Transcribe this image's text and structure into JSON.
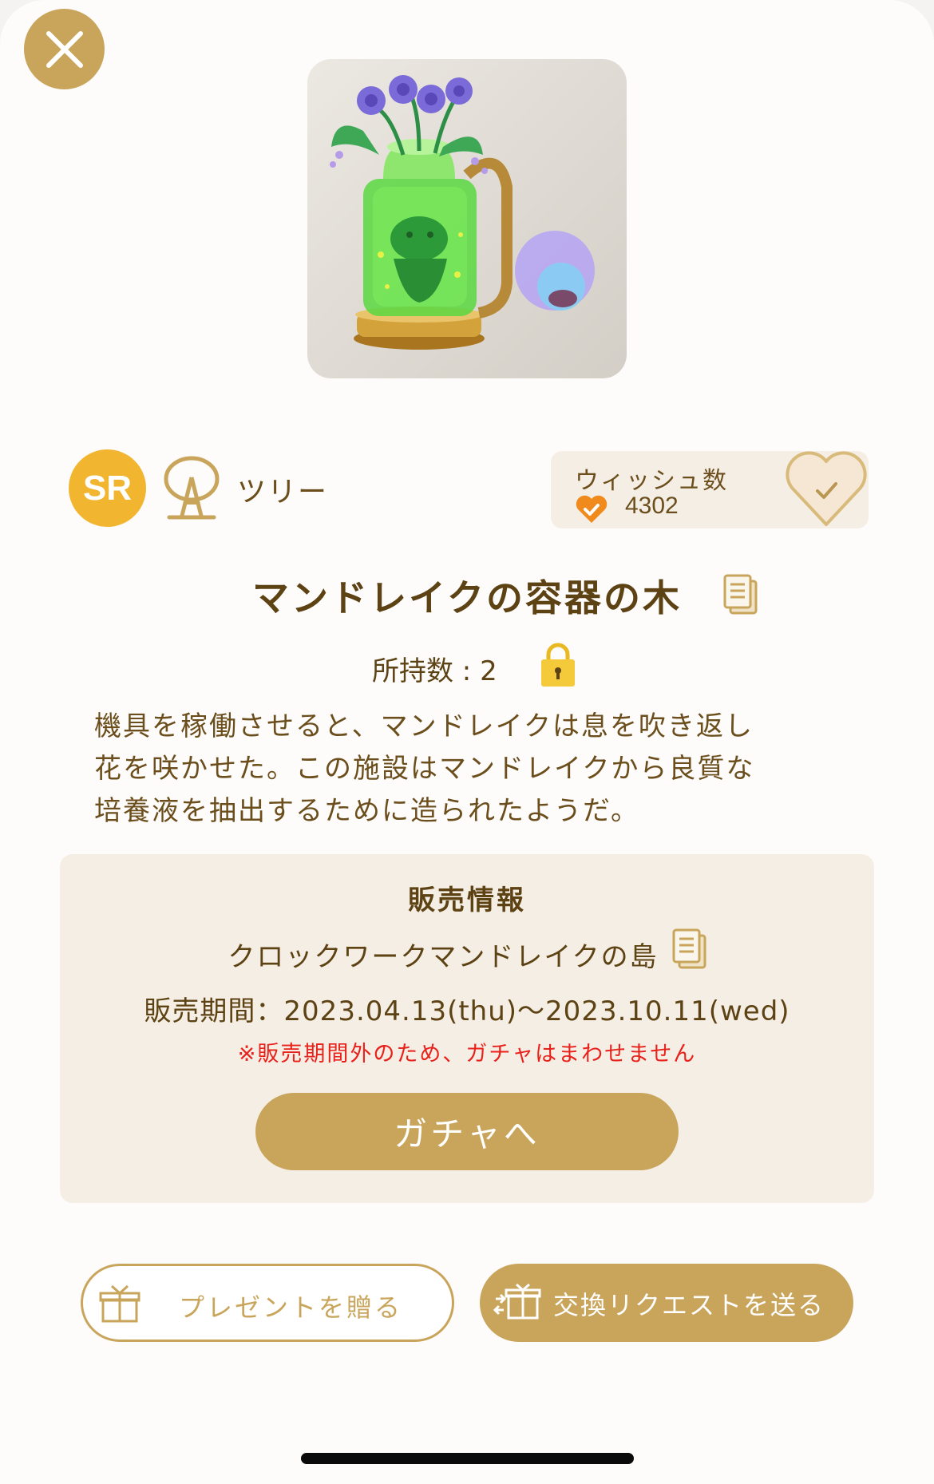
{
  "item": {
    "name": "マンドレイクの容器の木",
    "rarity": "SR",
    "category": "ツリー",
    "owned_label": "所持数 : 2",
    "description_lines": [
      "機具を稼働させると、マンドレイクは息を吹き返し",
      "花を咲かせた。この施設はマンドレイクから良質な",
      "培養液を抽出するために造られたようだ。"
    ]
  },
  "wish": {
    "label": "ウィッシュ数",
    "count": "4302"
  },
  "sales": {
    "heading": "販売情報",
    "island": "クロックワークマンドレイクの島",
    "period": "販売期間：2023.04.13(thu)〜2023.10.11(wed)",
    "warning": "※販売期間外のため、ガチャはまわせません",
    "gacha_button": "ガチャへ"
  },
  "actions": {
    "present_label": "プレゼントを贈る",
    "exchange_label": "交換リクエストを送る"
  },
  "colors": {
    "accent_gold": "#c9a55c",
    "rarity_yellow": "#f2b52f",
    "text_brown": "#6b4e1c",
    "panel_beige": "#f5eee4",
    "warning_red": "#e8211b",
    "heart_orange": "#f08a1c"
  },
  "icons": {
    "close": "close-icon",
    "category": "tree-category-icon",
    "wish_small": "heart-check-icon",
    "wish_toggle": "heart-outline-check-icon",
    "document": "document-icon",
    "lock": "lock-icon",
    "present": "gift-icon",
    "exchange": "exchange-gift-icon"
  }
}
